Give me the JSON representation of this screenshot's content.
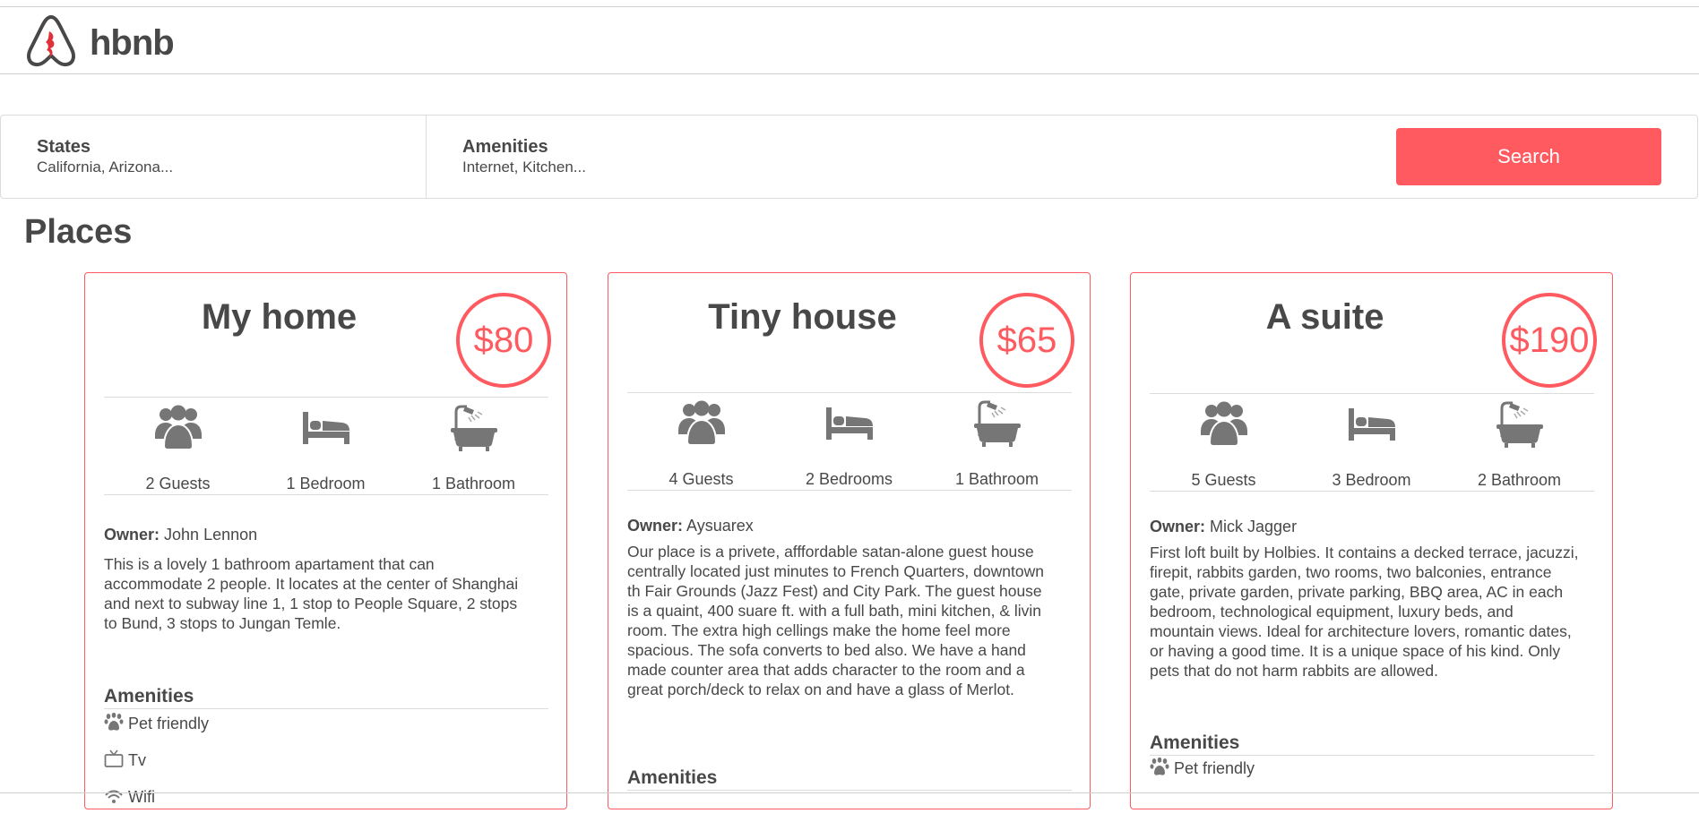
{
  "header": {
    "brand": "hbnb",
    "logo_icon": "hbnb-logo-icon"
  },
  "filters": {
    "states": {
      "title": "States",
      "value": "California, Arizona..."
    },
    "amenities": {
      "title": "Amenities",
      "value": "Internet, Kitchen..."
    },
    "search_label": "Search"
  },
  "places_title": "Places",
  "colors": {
    "accent": "#ff5a5f",
    "text": "#484848",
    "icon": "#767676",
    "line": "#dcdcdc"
  },
  "places": [
    {
      "name": "My home",
      "price": "$80",
      "guests": "2 Guests",
      "rooms": "1 Bedroom",
      "baths": "1 Bathroom",
      "owner_label": "Owner:",
      "owner": "John Lennon",
      "description": "This is a lovely 1 bathroom apartament that can accommodate 2 people. It locates at the center of Shanghai and next to subway line 1, 1 stop to People Square, 2 stops to Bund, 3 stops to Jungan Temle.",
      "amenities_title": "Amenities",
      "amenities": [
        {
          "icon": "paw-icon",
          "label": "Pet friendly"
        },
        {
          "icon": "tv-icon",
          "label": "Tv"
        },
        {
          "icon": "wifi-icon",
          "label": "Wifi"
        }
      ]
    },
    {
      "name": "Tiny house",
      "price": "$65",
      "guests": "4 Guests",
      "rooms": "2 Bedrooms",
      "baths": "1 Bathroom",
      "owner_label": "Owner:",
      "owner": "Aysuarex",
      "description": "Our place is a privete, afffordable satan-alone guest house centrally located just minutes to French Quarters, downtown th Fair Grounds (Jazz Fest) and City Park. The guest house is a quaint, 400 suare ft. with a full bath, mini kitchen, & livin room. The extra high cellings make the home feel more spacious. The sofa converts to bed also. We have a hand made counter area that adds character to the room and a great porch/deck to relax on and have a glass of Merlot.",
      "amenities_title": "Amenities",
      "amenities": []
    },
    {
      "name": "A suite",
      "price": "$190",
      "guests": "5 Guests",
      "rooms": "3 Bedroom",
      "baths": "2 Bathroom",
      "owner_label": "Owner:",
      "owner": "Mick Jagger",
      "description": "First loft built by Holbies. It contains a decked terrace, jacuzzi, firepit, rabbits garden, two rooms, two balconies, entrance gate, private garden, private parking, BBQ area, AC in each bedroom, technological equipment, luxury beds, and mountain views. Ideal for architecture lovers, romantic dates, or having a good time. It is a unique space of his kind. Only pets that do not harm rabbits are allowed.",
      "amenities_title": "Amenities",
      "amenities": [
        {
          "icon": "paw-icon",
          "label": "Pet friendly"
        }
      ]
    }
  ]
}
